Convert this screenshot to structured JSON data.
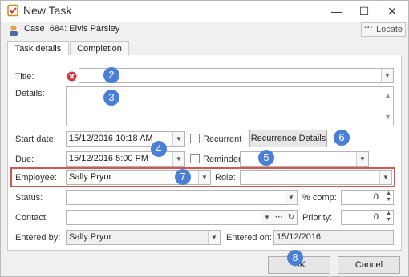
{
  "window": {
    "title": "New Task"
  },
  "case": {
    "label": "Case",
    "number": "684:",
    "name": "Elvis Parsley",
    "locate_label": "Locate"
  },
  "tabs": [
    {
      "label": "Task details"
    },
    {
      "label": "Completion"
    }
  ],
  "fields": {
    "title_label": "Title:",
    "details_label": "Details:",
    "start_date_label": "Start date:",
    "start_date_value": "15/12/2016 10:18 AM",
    "recurrent_label": "Recurrent",
    "recurrence_details_label": "Recurrence Details",
    "due_label": "Due:",
    "due_value": "15/12/2016 5:00 PM",
    "reminder_label": "Reminder",
    "employee_label": "Employee:",
    "employee_value": "Sally Pryor",
    "role_label": "Role:",
    "status_label": "Status:",
    "percent_comp_label": "% comp:",
    "percent_comp_value": "0",
    "contact_label": "Contact:",
    "priority_label": "Priority:",
    "priority_value": "0",
    "entered_by_label": "Entered by:",
    "entered_by_value": "Sally Pryor",
    "entered_on_label": "Entered on:",
    "entered_on_value": "15/12/2016"
  },
  "markers": [
    "2",
    "3",
    "4",
    "5",
    "6",
    "7",
    "8"
  ],
  "buttons": {
    "ok_label": "OK",
    "cancel_label": "Cancel"
  },
  "colors": {
    "marker": "#4a7fd8",
    "highlight_border": "#d9534f",
    "error_icon": "#d0393e"
  }
}
